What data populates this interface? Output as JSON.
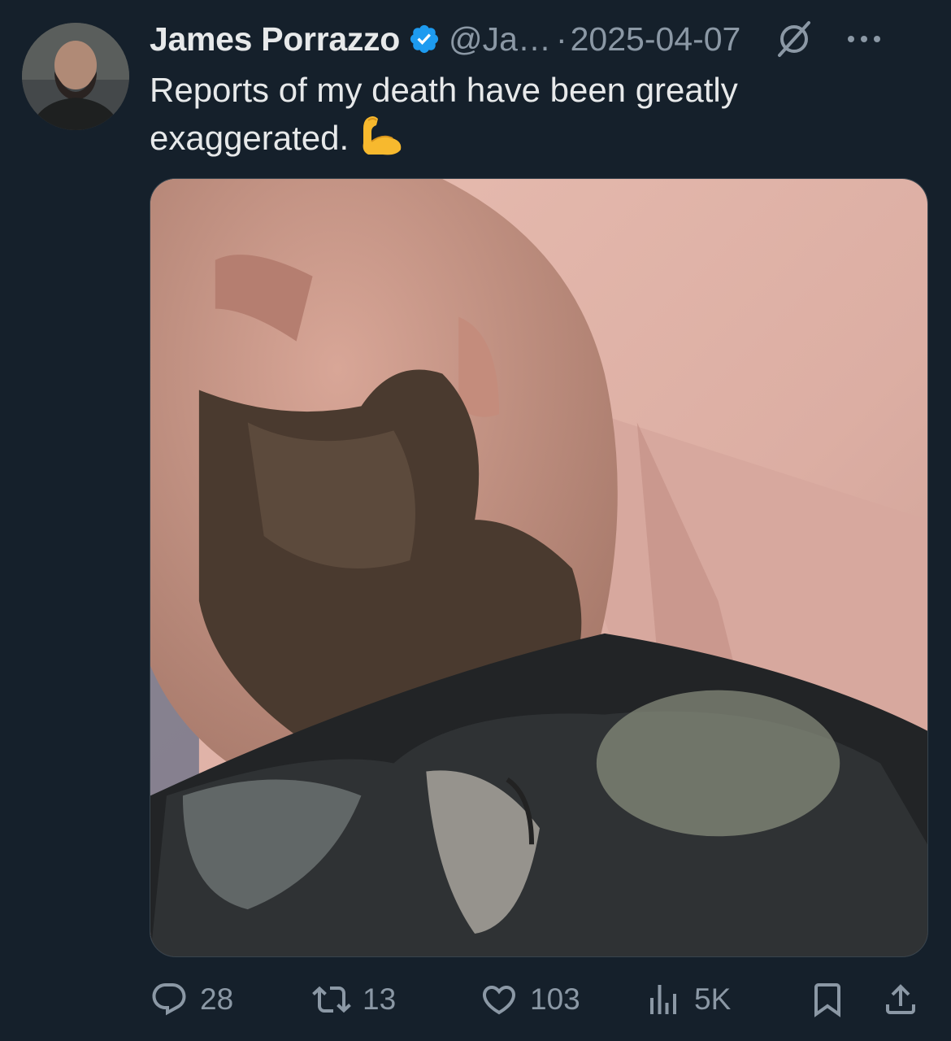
{
  "author": {
    "name": "James Porrazzo",
    "handle": "@Ja…",
    "separator": "·",
    "date": "2025-04-07",
    "verified_color": "#1d9bf0"
  },
  "tweet": {
    "text": "Reports of my death have been greatly exaggerated.",
    "emoji": "flexed-biceps"
  },
  "media": {
    "kind": "photo"
  },
  "actions": {
    "replies": "28",
    "retweets": "13",
    "likes": "103",
    "views": "5K"
  },
  "colors": {
    "background": "#15202b",
    "text_primary": "#e7e9ea",
    "text_secondary": "#8b98a5"
  }
}
